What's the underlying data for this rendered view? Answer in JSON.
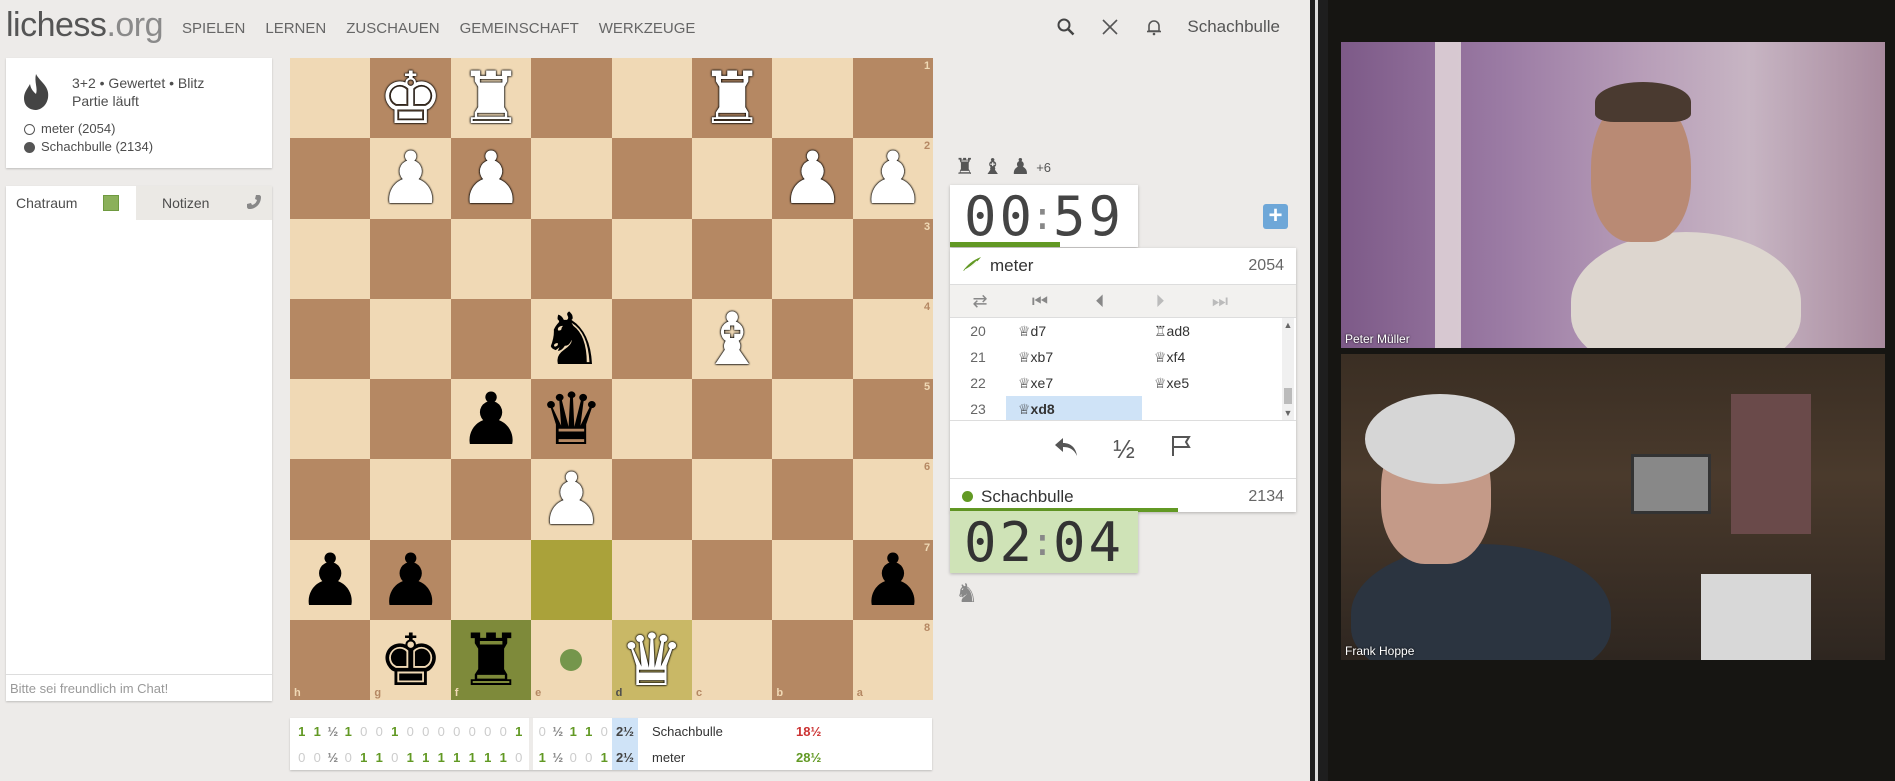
{
  "header": {
    "logo_main": "lichess",
    "logo_ext": ".org",
    "nav": [
      "SPIELEN",
      "LERNEN",
      "ZUSCHAUEN",
      "GEMEINSCHAFT",
      "WERKZEUGE"
    ],
    "username": "Schachbulle"
  },
  "game_meta": {
    "setup": "3+2 • Gewertet • Blitz",
    "status": "Partie läuft",
    "white_player": "meter (2054)",
    "black_player": "Schachbulle (2134)"
  },
  "chat": {
    "tab_chat": "Chatraum",
    "tab_notes": "Notizen",
    "placeholder": "Bitte sei freundlich im Chat!"
  },
  "board": {
    "orientation": "black",
    "ranks": [
      "1",
      "2",
      "3",
      "4",
      "5",
      "6",
      "7",
      "8"
    ],
    "files": [
      "h",
      "g",
      "f",
      "e",
      "d",
      "c",
      "b",
      "a"
    ],
    "rows": [
      [
        "",
        "wK",
        "wR",
        "",
        "",
        "wR",
        "",
        ""
      ],
      [
        "",
        "wP",
        "wP",
        "",
        "",
        "",
        "wP",
        "wP"
      ],
      [
        "",
        "",
        "",
        "",
        "",
        "",
        "",
        ""
      ],
      [
        "",
        "",
        "",
        "bN",
        "",
        "wB",
        "",
        ""
      ],
      [
        "",
        "",
        "bP",
        "bQ",
        "",
        "",
        "",
        ""
      ],
      [
        "",
        "",
        "",
        "wP",
        "",
        "",
        "",
        ""
      ],
      [
        "bP",
        "bP",
        "",
        "",
        "",
        "",
        "",
        "bP"
      ],
      [
        "",
        "bK",
        "bR",
        "",
        "wQ",
        "",
        "",
        ""
      ]
    ],
    "last_move_from": "e7",
    "last_move_to": "d8",
    "move_dest": "e8"
  },
  "crosstable": {
    "rows": [
      {
        "results": [
          "1",
          "1",
          "½",
          "1",
          "0",
          "0",
          "1",
          "0",
          "0",
          "0",
          "0",
          "0",
          "0",
          "0",
          "1"
        ],
        "recent": [
          "0",
          "½",
          "1",
          "1",
          "0"
        ],
        "sum": "2½",
        "name": "Schachbulle",
        "score": "18½",
        "score_color": "#c33"
      },
      {
        "results": [
          "0",
          "0",
          "½",
          "0",
          "1",
          "1",
          "0",
          "1",
          "1",
          "1",
          "1",
          "1",
          "1",
          "1",
          "0"
        ],
        "recent": [
          "1",
          "½",
          "0",
          "0",
          "1"
        ],
        "sum": "2½",
        "name": "meter",
        "score": "28½",
        "score_color": "#629924"
      }
    ]
  },
  "material": {
    "pieces": [
      "♜",
      "♝",
      "♟"
    ],
    "plus": "+6"
  },
  "clock_top": {
    "min": "00",
    "sec": "59"
  },
  "clock_bottom": {
    "min": "02",
    "sec": "04"
  },
  "players": {
    "top": {
      "name": "meter",
      "rating": "2054"
    },
    "bottom": {
      "name": "Schachbulle",
      "rating": "2134"
    }
  },
  "moves": [
    {
      "num": "20",
      "white": "♕d7",
      "black": "♖ad8"
    },
    {
      "num": "21",
      "white": "♕xb7",
      "black": "♕xf4"
    },
    {
      "num": "22",
      "white": "♕xe7",
      "black": "♕xe5"
    },
    {
      "num": "23",
      "white": "♕xd8",
      "black": ""
    }
  ],
  "actions": {
    "draw": "½"
  },
  "video": {
    "top_name": "Peter Müller",
    "bottom_name": "Frank Hoppe"
  },
  "colors": {
    "light_square": "#f0d9b5",
    "dark_square": "#b58863",
    "accent_green": "#629924",
    "highlight": "#cfe3f7"
  }
}
